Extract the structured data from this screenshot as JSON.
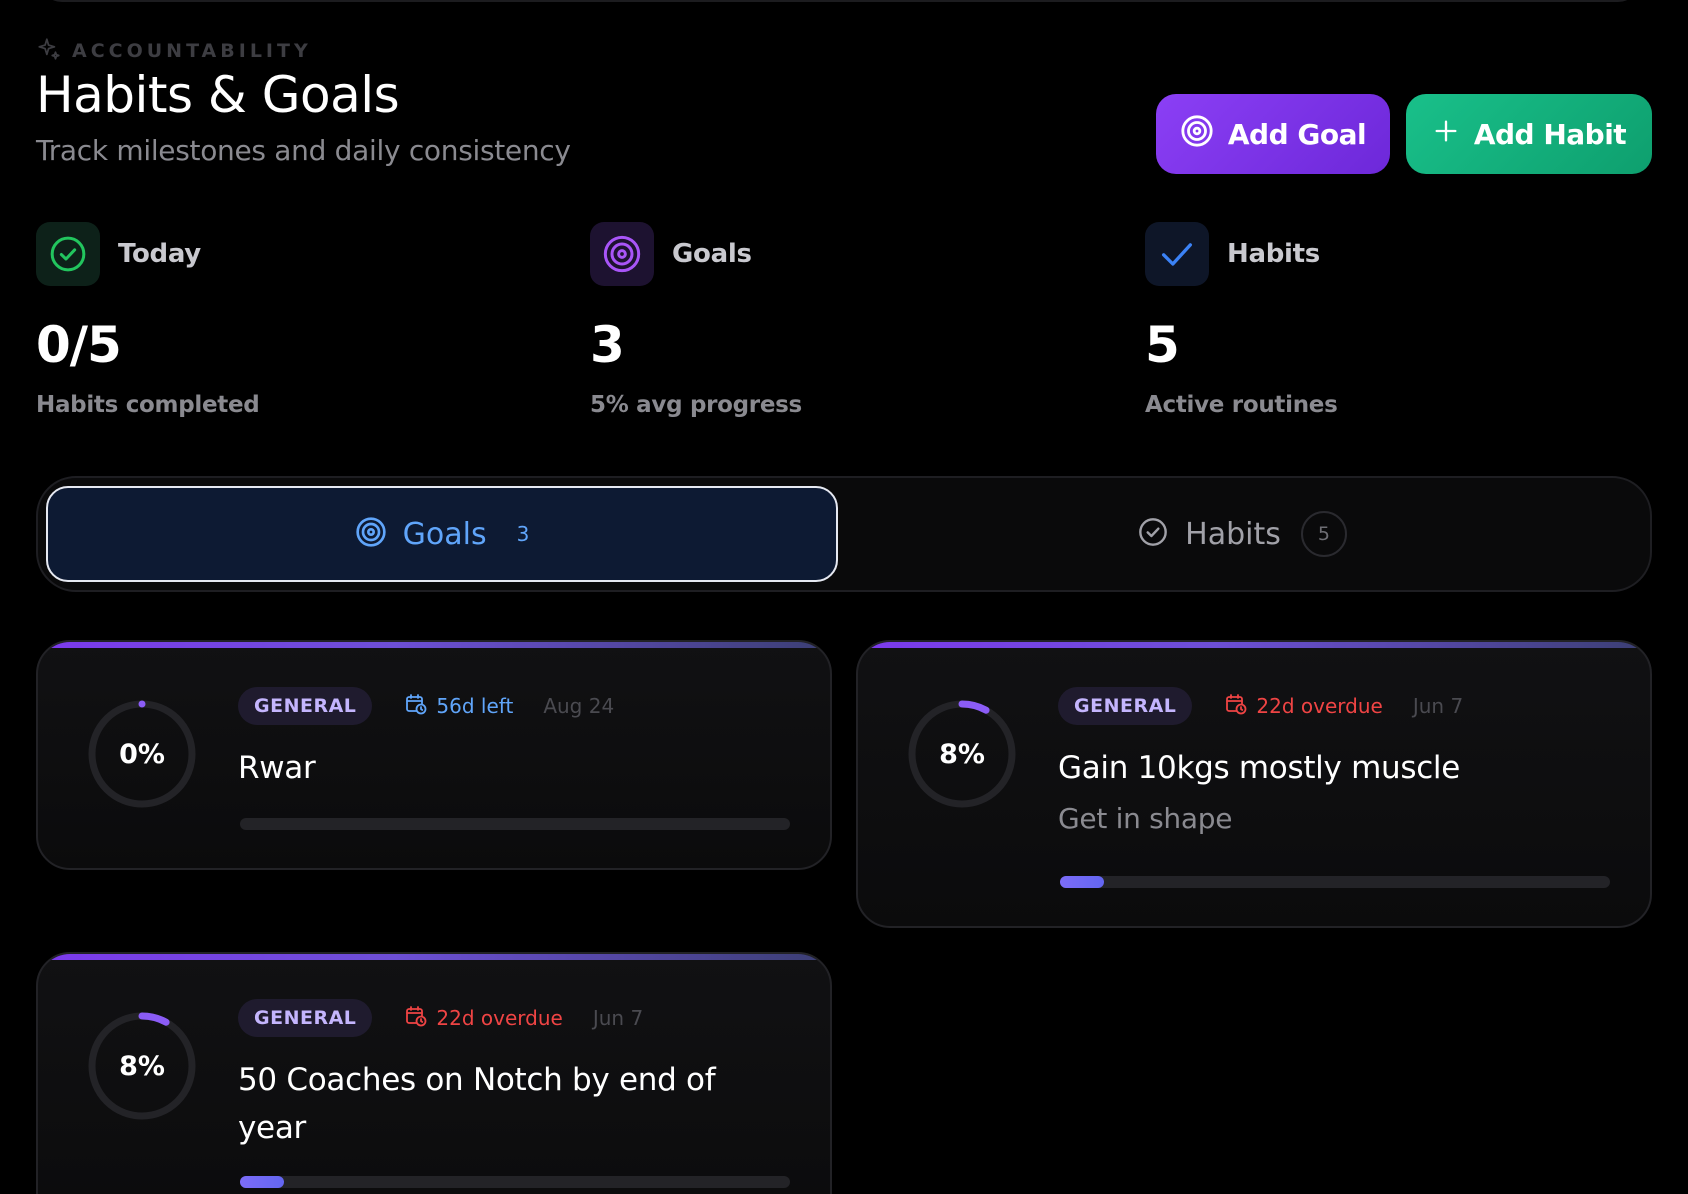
{
  "header": {
    "eyebrow": "ACCOUNTABILITY",
    "title": "Habits & Goals",
    "subtitle": "Track milestones and daily consistency"
  },
  "actions": {
    "add_goal": "Add Goal",
    "add_habit": "Add Habit"
  },
  "stats": [
    {
      "label": "Today",
      "value": "0/5",
      "caption": "Habits completed",
      "icon": "check-circle-icon",
      "color": "#22c55e"
    },
    {
      "label": "Goals",
      "value": "3",
      "caption": "5% avg progress",
      "icon": "target-icon",
      "color": "#a855f7"
    },
    {
      "label": "Habits",
      "value": "5",
      "caption": "Active routines",
      "icon": "check-icon",
      "color": "#3b82f6"
    }
  ],
  "tabs": [
    {
      "label": "Goals",
      "count": "3",
      "active": true
    },
    {
      "label": "Habits",
      "count": "5",
      "active": false
    }
  ],
  "goals": [
    {
      "progress_label": "0%",
      "progress": 0.0,
      "category": "GENERAL",
      "due_text": "56d left",
      "due_status": "upcoming",
      "date": "Aug 24",
      "title": "Rwar",
      "description": ""
    },
    {
      "progress_label": "8%",
      "progress": 0.08,
      "category": "GENERAL",
      "due_text": "22d overdue",
      "due_status": "overdue",
      "date": "Jun 7",
      "title": "Gain 10kgs mostly muscle",
      "description": "Get in shape"
    },
    {
      "progress_label": "8%",
      "progress": 0.08,
      "category": "GENERAL",
      "due_text": "22d overdue",
      "due_status": "overdue",
      "date": "Jun 7",
      "title": "50 Coaches on Notch by end of year",
      "description": ""
    }
  ],
  "colors": {
    "accent_purple": "#7c3aed",
    "accent_green": "#10b981",
    "accent_blue": "#60a5fa",
    "overdue_red": "#ef4444"
  }
}
